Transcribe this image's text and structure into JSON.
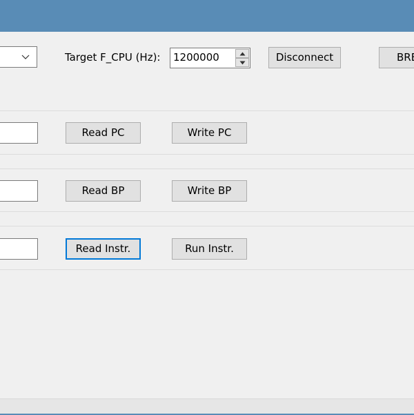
{
  "window": {
    "title": ""
  },
  "toolbar": {
    "port_combo_value": "",
    "target_fcpu_label": "Target F_CPU (Hz):",
    "target_fcpu_value": "1200000",
    "disconnect_label": "Disconnect",
    "break_label": "BRE"
  },
  "pc_group": {
    "value": "",
    "read_label": "Read PC",
    "write_label": "Write PC"
  },
  "bp_group": {
    "value": "",
    "read_label": "Read BP",
    "write_label": "Write BP"
  },
  "instr_group": {
    "value": "",
    "read_label": "Read Instr.",
    "run_label": "Run Instr."
  },
  "colors": {
    "titlebar": "#598cb6",
    "window_bg": "#f0f0f0",
    "button_bg": "#e1e1e1",
    "focus_border": "#0078d7"
  }
}
